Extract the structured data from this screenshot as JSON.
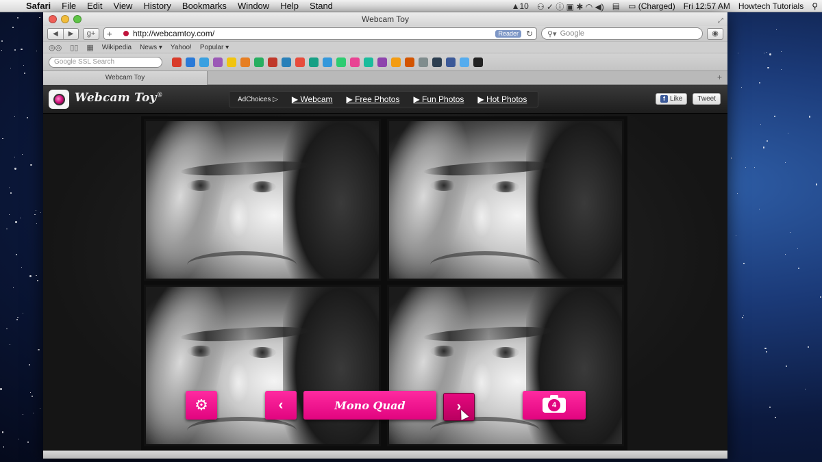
{
  "menubar": {
    "app": "Safari",
    "items": [
      "File",
      "Edit",
      "View",
      "History",
      "Bookmarks",
      "Window",
      "Help",
      "Stand"
    ],
    "status": {
      "adobe": "10",
      "battery": "(Charged)",
      "clock": "Fri 12:57 AM",
      "user": "Howtech Tutorials"
    }
  },
  "window": {
    "title": "Webcam Toy",
    "url": "http://webcamtoy.com/",
    "reader_label": "Reader",
    "search_placeholder": "Google",
    "bookmarks": [
      "Wikipedia",
      "News ▾",
      "Yahoo!",
      "Popular ▾"
    ],
    "ssl_search_placeholder": "Google SSL Search",
    "tab_label": "Webcam Toy"
  },
  "extension_colors": [
    "#d83b2a",
    "#2a7ad8",
    "#3aa0e0",
    "#9b59b6",
    "#f1c40f",
    "#e67e22",
    "#27ae60",
    "#c0392b",
    "#2980b9",
    "#e74c3c",
    "#16a085",
    "#3498db",
    "#2ecc71",
    "#e84393",
    "#1abc9c",
    "#8e44ad",
    "#f39c12",
    "#d35400",
    "#7f8c8d",
    "#2c3e50",
    "#3b5998",
    "#55acee",
    "#222222"
  ],
  "site": {
    "brand": "Webcam Toy",
    "brand_mark": "®",
    "adchoices": "AdChoices",
    "nav": [
      "▶ Webcam",
      "▶ Free Photos",
      "▶ Fun Photos",
      "▶ Hot Photos"
    ],
    "like_label": "Like",
    "tweet_label": "Tweet",
    "accent_color": "#e1047f"
  },
  "controls": {
    "effect_name": "Mono Quad",
    "shot_count": "4",
    "settings_icon": "gear-icon",
    "prev_icon": "chevron-left-icon",
    "next_icon": "chevron-right-icon",
    "shoot_icon": "camera-icon"
  }
}
